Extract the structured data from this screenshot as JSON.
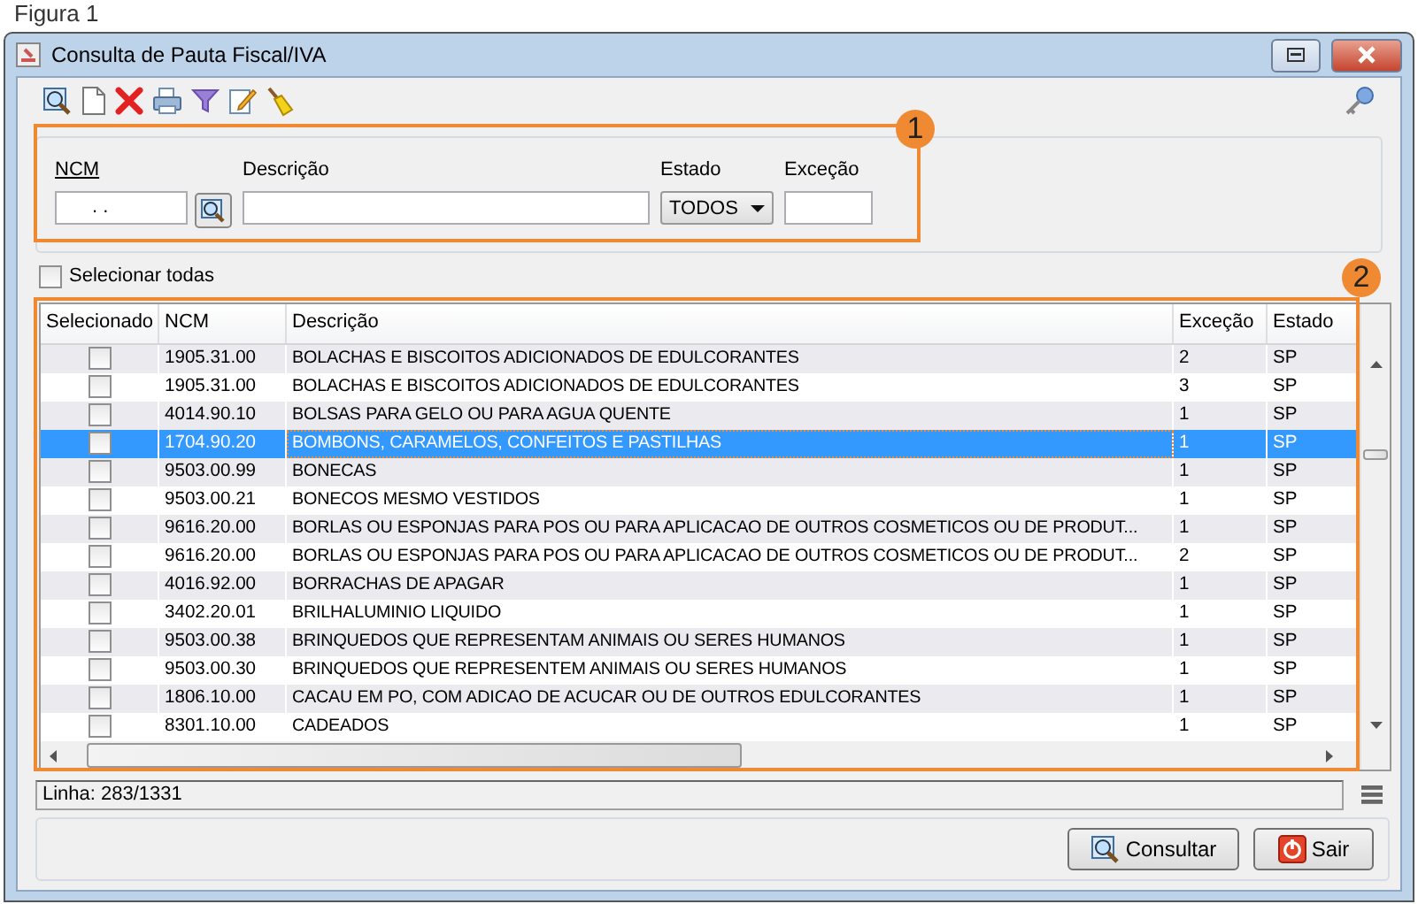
{
  "caption": "Figura 1",
  "window": {
    "title": "Consulta de Pauta Fiscal/IVA"
  },
  "filters": {
    "ncm_label": "NCM",
    "ncm_value": ". .",
    "descricao_label": "Descrição",
    "estado_label": "Estado",
    "estado_value": "TODOS",
    "excecao_label": "Exceção"
  },
  "annotations": [
    "1",
    "2"
  ],
  "select_all": {
    "label": "Selecionar todas",
    "checked": false
  },
  "table": {
    "columns": [
      "Selecionado",
      "NCM",
      "Descrição",
      "Exceção",
      "Estado"
    ],
    "rows": [
      {
        "checked": false,
        "ncm": "1905.31.00",
        "descricao": "BOLACHAS E BISCOITOS ADICIONADOS DE EDULCORANTES",
        "excecao": "2",
        "estado": "SP",
        "selected": false
      },
      {
        "checked": false,
        "ncm": "1905.31.00",
        "descricao": "BOLACHAS E BISCOITOS ADICIONADOS DE EDULCORANTES",
        "excecao": "3",
        "estado": "SP",
        "selected": false
      },
      {
        "checked": false,
        "ncm": "4014.90.10",
        "descricao": "BOLSAS PARA GELO OU PARA AGUA QUENTE",
        "excecao": "1",
        "estado": "SP",
        "selected": false
      },
      {
        "checked": false,
        "ncm": "1704.90.20",
        "descricao": "BOMBONS, CARAMELOS, CONFEITOS E PASTILHAS",
        "excecao": "1",
        "estado": "SP",
        "selected": true
      },
      {
        "checked": false,
        "ncm": "9503.00.99",
        "descricao": "BONECAS",
        "excecao": "1",
        "estado": "SP",
        "selected": false
      },
      {
        "checked": false,
        "ncm": "9503.00.21",
        "descricao": "BONECOS MESMO VESTIDOS",
        "excecao": "1",
        "estado": "SP",
        "selected": false
      },
      {
        "checked": false,
        "ncm": "9616.20.00",
        "descricao": "BORLAS OU ESPONJAS PARA POS OU PARA APLICACAO DE OUTROS COSMETICOS OU DE PRODUT...",
        "excecao": "1",
        "estado": "SP",
        "selected": false
      },
      {
        "checked": false,
        "ncm": "9616.20.00",
        "descricao": "BORLAS OU ESPONJAS PARA POS OU PARA APLICACAO DE OUTROS COSMETICOS OU DE PRODUT...",
        "excecao": "2",
        "estado": "SP",
        "selected": false
      },
      {
        "checked": false,
        "ncm": "4016.92.00",
        "descricao": "BORRACHAS DE APAGAR",
        "excecao": "1",
        "estado": "SP",
        "selected": false
      },
      {
        "checked": false,
        "ncm": "3402.20.01",
        "descricao": "BRILHALUMINIO LIQUIDO",
        "excecao": "1",
        "estado": "SP",
        "selected": false
      },
      {
        "checked": false,
        "ncm": "9503.00.38",
        "descricao": "BRINQUEDOS QUE REPRESENTAM ANIMAIS OU SERES HUMANOS",
        "excecao": "1",
        "estado": "SP",
        "selected": false
      },
      {
        "checked": false,
        "ncm": "9503.00.30",
        "descricao": "BRINQUEDOS QUE REPRESENTEM ANIMAIS OU SERES HUMANOS",
        "excecao": "1",
        "estado": "SP",
        "selected": false
      },
      {
        "checked": false,
        "ncm": "1806.10.00",
        "descricao": "CACAU EM PO, COM ADICAO DE ACUCAR OU DE OUTROS EDULCORANTES",
        "excecao": "1",
        "estado": "SP",
        "selected": false
      },
      {
        "checked": false,
        "ncm": "8301.10.00",
        "descricao": "CADEADOS",
        "excecao": "1",
        "estado": "SP",
        "selected": false
      }
    ]
  },
  "status": "Linha: 283/1331",
  "buttons": [
    {
      "label": "Consultar",
      "kind": "search"
    },
    {
      "label": "Sair",
      "kind": "exit"
    }
  ]
}
